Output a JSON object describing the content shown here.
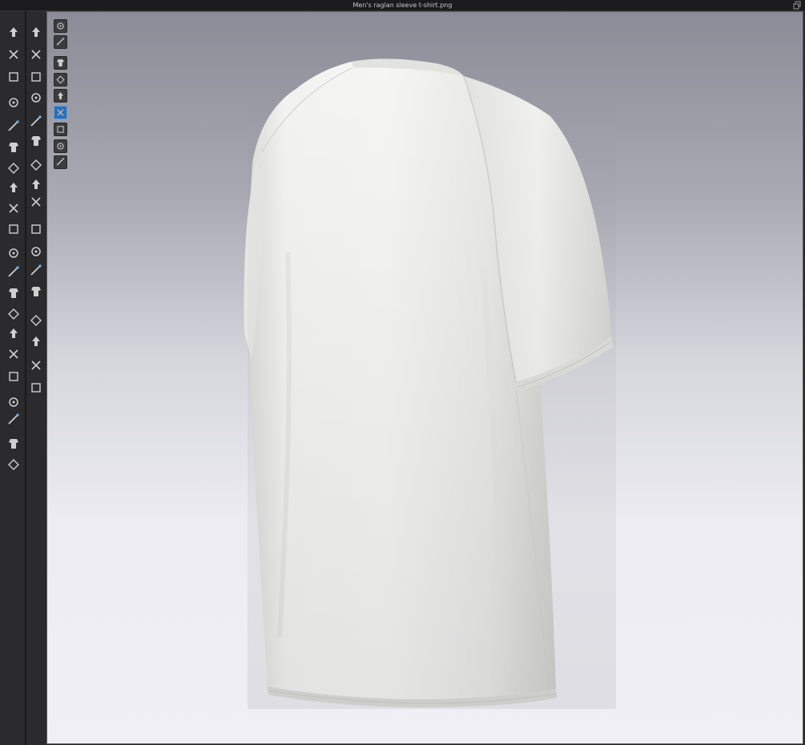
{
  "window": {
    "title": "Men's raglan sleeve t-shirt.png"
  },
  "left_toolbar": {
    "column_a": [
      {
        "name": "move-down-icon"
      },
      {
        "name": "transform-pattern-icon"
      },
      {
        "name": "edit-curve-icon"
      },
      {
        "name": "garment-fit-icon"
      },
      {
        "name": "segment-rotate-icon"
      },
      {
        "name": "point-on-line-icon"
      },
      {
        "name": "curve-point-icon"
      },
      {
        "name": "sewing-machine-icon"
      },
      {
        "name": "line-tool-icon"
      },
      {
        "name": "hide-eye-icon"
      },
      {
        "name": "texture-brush-icon"
      },
      {
        "name": "fabric-box-icon"
      },
      {
        "name": "fold-garment-icon"
      },
      {
        "name": "arrange-box-icon"
      },
      {
        "name": "pin-tool-icon"
      },
      {
        "name": "avatar-figure-icon"
      },
      {
        "name": "measure-tape-icon"
      },
      {
        "name": "ruler-diagonal-icon"
      },
      {
        "name": "pen-tool-icon"
      },
      {
        "name": "shirt-front-icon"
      },
      {
        "name": "shirt-back-icon"
      }
    ],
    "column_b": [
      {
        "name": "avatar-pose-icon"
      },
      {
        "name": "select-move-icon"
      },
      {
        "name": "sew-segment-icon"
      },
      {
        "name": "free-sew-icon"
      },
      {
        "name": "seam-taping-icon"
      },
      {
        "name": "cut-seam-icon"
      },
      {
        "name": "stitch-icon"
      },
      {
        "name": "zipper-icon"
      },
      {
        "name": "buttonhole-icon"
      },
      {
        "name": "button-icon"
      },
      {
        "name": "button-lock-icon"
      },
      {
        "name": "avatar-size-icon"
      },
      {
        "name": "panel-toggle-icon"
      },
      {
        "name": "square-panel-icon"
      },
      {
        "name": "panel-duplicate-icon"
      },
      {
        "name": "square-solid-icon"
      },
      {
        "name": "split-arrows-icon"
      }
    ]
  },
  "viewport_toolbar": [
    {
      "name": "display-avatar-icon",
      "active": false
    },
    {
      "name": "display-garment-icon",
      "active": false
    },
    {
      "name": "garment-view-icon",
      "active": false
    },
    {
      "name": "fabric-mode-icon",
      "active": false
    },
    {
      "name": "avatar-view-icon",
      "active": false
    },
    {
      "name": "texture-surface-icon",
      "active": true
    },
    {
      "name": "thickness-render-icon",
      "active": false
    },
    {
      "name": "avatar-silhouette-icon",
      "active": false
    },
    {
      "name": "mesh-globe-icon",
      "active": false
    }
  ],
  "colors": {
    "background_top": "#8b8c97",
    "background_bottom": "#efeff5",
    "garment": "#f0f0ee",
    "active_button": "#2e6fb3"
  }
}
